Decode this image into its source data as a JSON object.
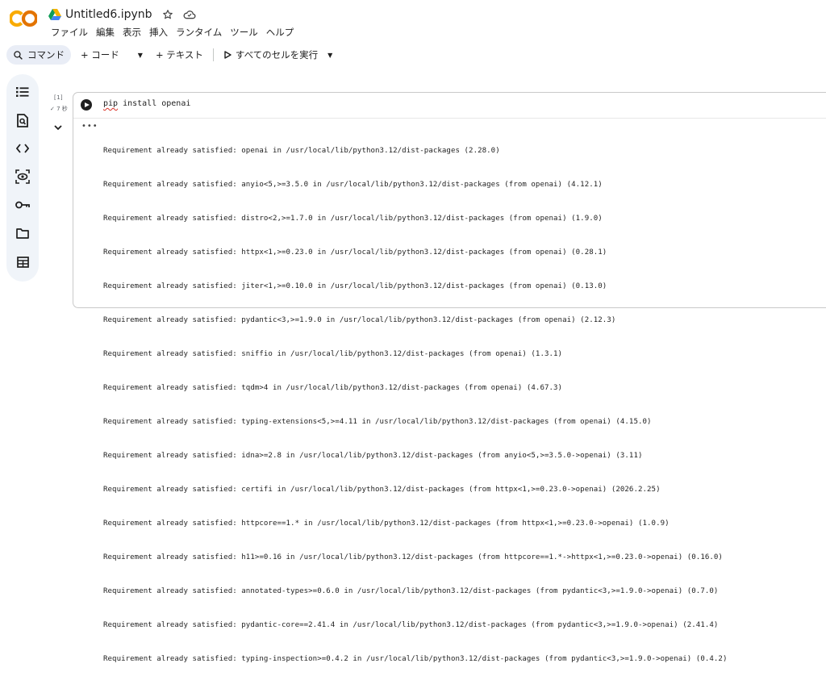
{
  "app": {
    "logo_label": "CO",
    "doc_title": "Untitled6.ipynb",
    "brand_colors": {
      "logo_orange": "#f9ab00",
      "logo_dark_orange": "#e37400",
      "drive_blue": "#4285f4",
      "drive_green": "#0f9d58",
      "drive_yellow": "#f4b400"
    }
  },
  "menubar": {
    "items": [
      "ファイル",
      "編集",
      "表示",
      "挿入",
      "ランタイム",
      "ツール",
      "ヘルプ"
    ]
  },
  "toolbar": {
    "search_label": "コマンド",
    "add_code_label": "+ コード",
    "add_text_label": "+ テキスト",
    "run_all_label": "すべてのセルを実行"
  },
  "sidebar": {
    "icons": [
      "table-of-contents-icon",
      "find-replace-icon",
      "code-snippets-icon",
      "variables-icon",
      "secrets-key-icon",
      "files-folder-icon",
      "data-table-icon"
    ]
  },
  "cell": {
    "execution_count": "[1]",
    "execution_time": "7 秒",
    "code_prefix": "pip",
    "code_rest": " install openai",
    "output_lines": [
      "Requirement already satisfied: openai in /usr/local/lib/python3.12/dist-packages (2.28.0)",
      "Requirement already satisfied: anyio<5,>=3.5.0 in /usr/local/lib/python3.12/dist-packages (from openai) (4.12.1)",
      "Requirement already satisfied: distro<2,>=1.7.0 in /usr/local/lib/python3.12/dist-packages (from openai) (1.9.0)",
      "Requirement already satisfied: httpx<1,>=0.23.0 in /usr/local/lib/python3.12/dist-packages (from openai) (0.28.1)",
      "Requirement already satisfied: jiter<1,>=0.10.0 in /usr/local/lib/python3.12/dist-packages (from openai) (0.13.0)",
      "Requirement already satisfied: pydantic<3,>=1.9.0 in /usr/local/lib/python3.12/dist-packages (from openai) (2.12.3)",
      "Requirement already satisfied: sniffio in /usr/local/lib/python3.12/dist-packages (from openai) (1.3.1)",
      "Requirement already satisfied: tqdm>4 in /usr/local/lib/python3.12/dist-packages (from openai) (4.67.3)",
      "Requirement already satisfied: typing-extensions<5,>=4.11 in /usr/local/lib/python3.12/dist-packages (from openai) (4.15.0)",
      "Requirement already satisfied: idna>=2.8 in /usr/local/lib/python3.12/dist-packages (from anyio<5,>=3.5.0->openai) (3.11)",
      "Requirement already satisfied: certifi in /usr/local/lib/python3.12/dist-packages (from httpx<1,>=0.23.0->openai) (2026.2.25)",
      "Requirement already satisfied: httpcore==1.* in /usr/local/lib/python3.12/dist-packages (from httpx<1,>=0.23.0->openai) (1.0.9)",
      "Requirement already satisfied: h11>=0.16 in /usr/local/lib/python3.12/dist-packages (from httpcore==1.*->httpx<1,>=0.23.0->openai) (0.16.0)",
      "Requirement already satisfied: annotated-types>=0.6.0 in /usr/local/lib/python3.12/dist-packages (from pydantic<3,>=1.9.0->openai) (0.7.0)",
      "Requirement already satisfied: pydantic-core==2.41.4 in /usr/local/lib/python3.12/dist-packages (from pydantic<3,>=1.9.0->openai) (2.41.4)",
      "Requirement already satisfied: typing-inspection>=0.4.2 in /usr/local/lib/python3.12/dist-packages (from pydantic<3,>=1.9.0->openai) (0.4.2)"
    ]
  }
}
